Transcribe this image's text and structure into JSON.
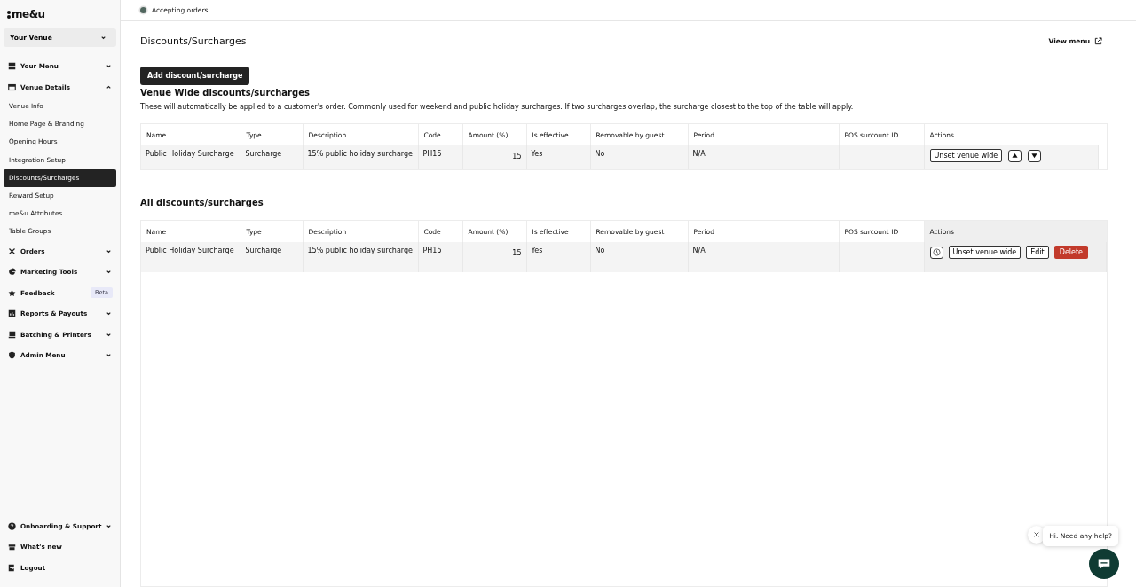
{
  "sidebar": {
    "logo": "me&u",
    "venue": "Your Venue",
    "items": [
      {
        "label": "Your Menu",
        "expanded": false
      },
      {
        "label": "Venue Details",
        "expanded": true,
        "children": [
          {
            "label": "Venue Info",
            "selected": false
          },
          {
            "label": "Home Page & Branding",
            "selected": false
          },
          {
            "label": "Opening Hours",
            "selected": false
          },
          {
            "label": "Integration Setup",
            "selected": false
          },
          {
            "label": "Discounts/Surcharges",
            "selected": true
          },
          {
            "label": "Reward Setup",
            "selected": false
          },
          {
            "label": "me&u Attributes",
            "selected": false
          },
          {
            "label": "Table Groups",
            "selected": false
          }
        ]
      },
      {
        "label": "Orders",
        "expanded": false
      },
      {
        "label": "Marketing Tools",
        "expanded": false
      },
      {
        "label": "Feedback",
        "badge": "Beta"
      },
      {
        "label": "Reports & Payouts",
        "expanded": false
      },
      {
        "label": "Batching & Printers",
        "expanded": false
      },
      {
        "label": "Admin Menu",
        "expanded": false
      }
    ],
    "bottom_items": [
      {
        "label": "Onboarding & Support",
        "expanded": false
      },
      {
        "label": "What's new"
      },
      {
        "label": "Logout"
      }
    ]
  },
  "status": {
    "label": "Accepting orders",
    "on": true
  },
  "page_title": "Discounts/Surcharges",
  "view_menu": "View menu",
  "add_button": "Add discount/surcharge",
  "venue_wide": {
    "title": "Venue Wide discounts/surcharges",
    "description": "These will automatically be applied to a customer's order. Commonly used for weekend and public holiday surcharges. If two surcharges overlap, the surcharge closest to the top of the table will apply.",
    "columns": [
      "Name",
      "Type",
      "Description",
      "Code",
      "Amount (%)",
      "Is effective",
      "Removable by guest",
      "Period",
      "POS surcount ID",
      "Actions"
    ],
    "rows": [
      {
        "cells": [
          "Public Holiday Surcharge",
          "Surcharge",
          "15% public holiday surcharge",
          "PH15",
          "15",
          "Yes",
          "No",
          "N/A",
          ""
        ],
        "actions": [
          {
            "kind": "text",
            "label": "Unset venue wide"
          },
          {
            "kind": "up"
          },
          {
            "kind": "down"
          }
        ]
      }
    ]
  },
  "all": {
    "title": "All discounts/surcharges",
    "columns": [
      "Name",
      "Type",
      "Description",
      "Code",
      "Amount (%)",
      "Is effective",
      "Removable by guest",
      "Period",
      "POS surcount ID",
      "Actions"
    ],
    "rows": [
      {
        "cells": [
          "Public Holiday Surcharge",
          "Surcharge",
          "15% public holiday surcharge",
          "PH15",
          "15",
          "Yes",
          "No",
          "N/A",
          ""
        ],
        "actions": [
          {
            "kind": "clock"
          },
          {
            "kind": "text",
            "label": "Unset venue wide"
          },
          {
            "kind": "text",
            "label": "Edit"
          },
          {
            "kind": "danger",
            "label": "Delete"
          }
        ]
      }
    ]
  },
  "chat": {
    "greeting": "Hi. Need any help?"
  }
}
